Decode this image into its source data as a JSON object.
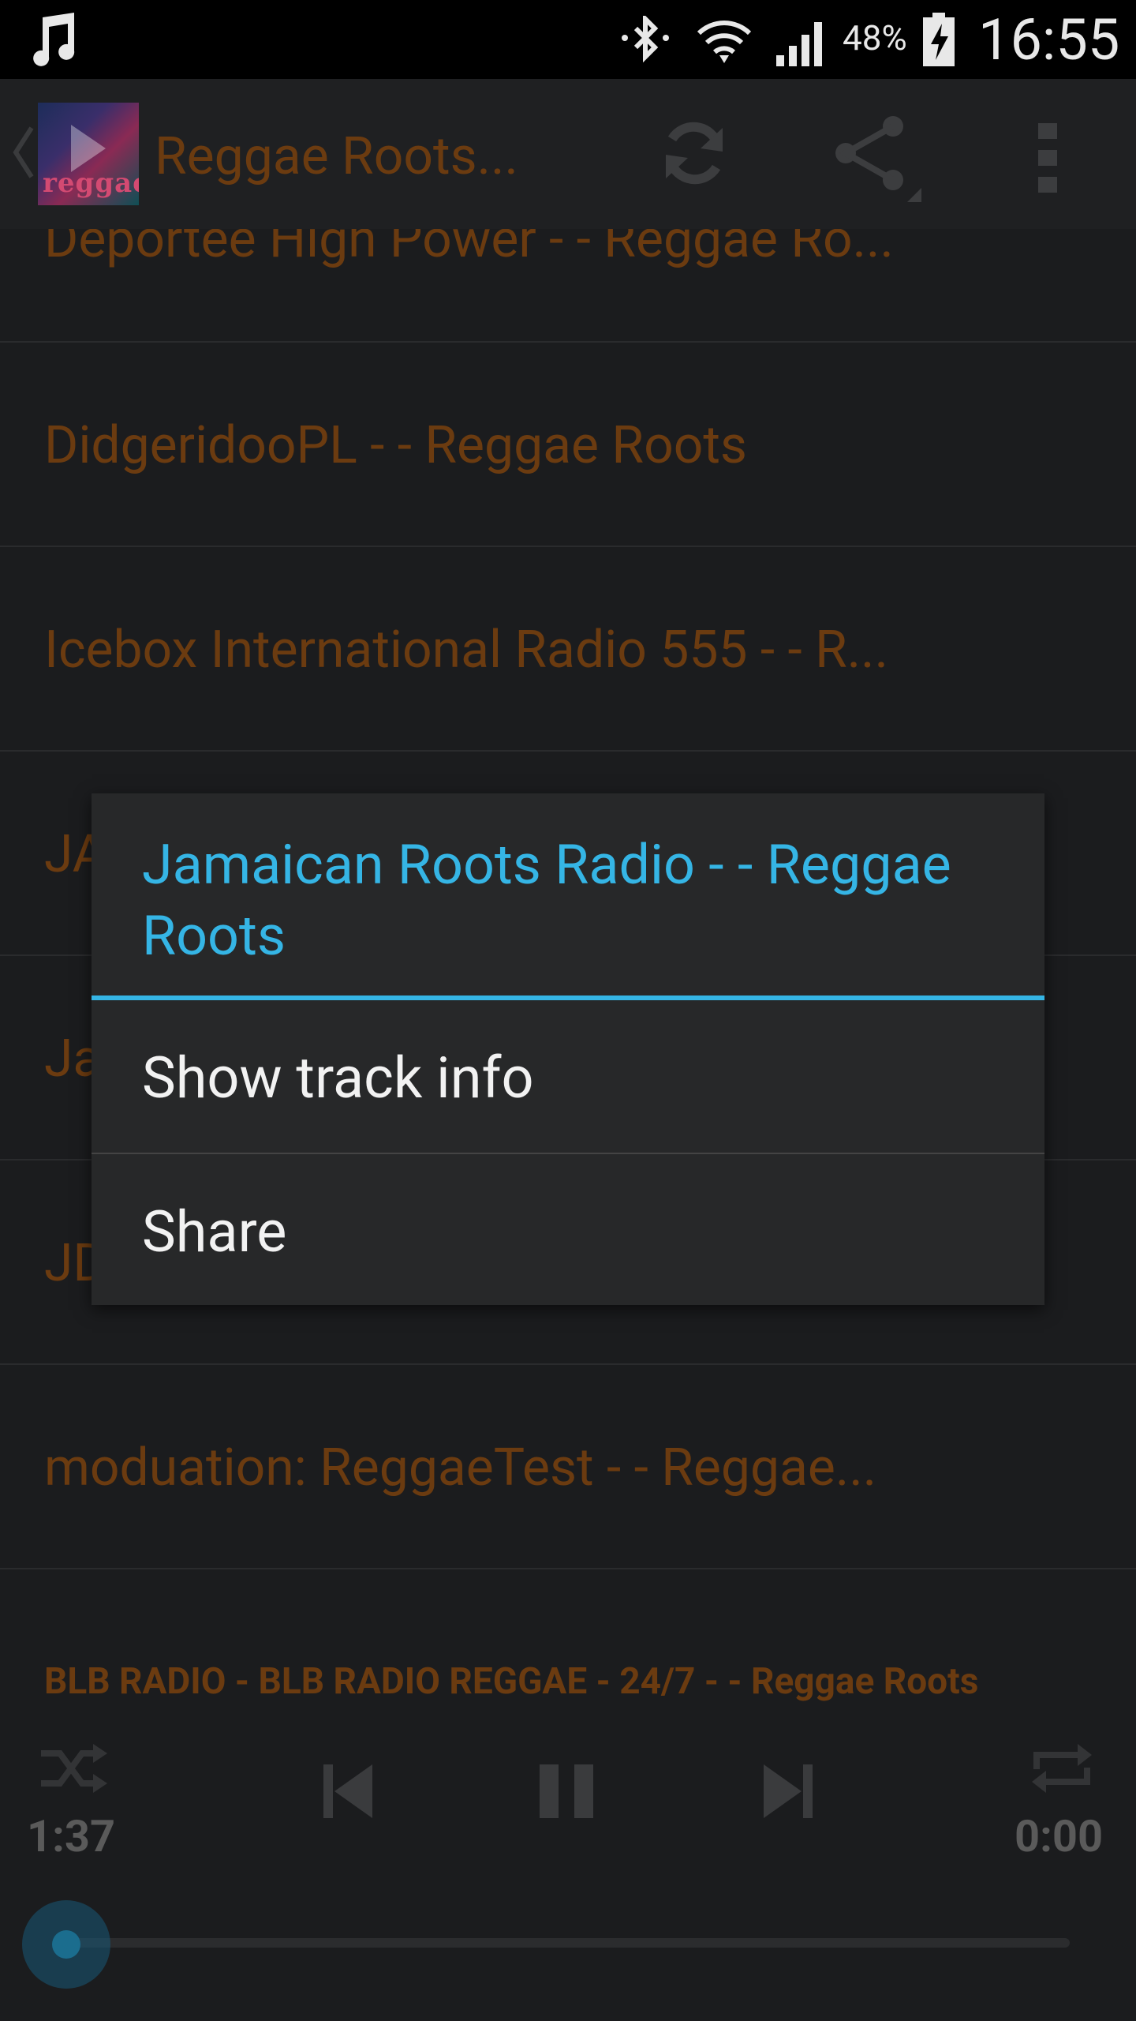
{
  "status_bar": {
    "battery_percent": "48%",
    "clock": "16:55"
  },
  "action_bar": {
    "title": "Reggae Roots...",
    "logo_text": "reggae",
    "icons": [
      "back-chevron-icon",
      "refresh-icon",
      "share-icon",
      "overflow-menu-icon"
    ]
  },
  "stations": [
    {
      "label": "Deportee High Power - - Reggae Ro..."
    },
    {
      "label": "DidgeridooPL - - Reggae Roots"
    },
    {
      "label": "Icebox International Radio 555 - - R..."
    },
    {
      "label": "JA"
    },
    {
      "label": "Ja"
    },
    {
      "label": "JD"
    },
    {
      "label": "moduation: ReggaeTest - - Reggae..."
    }
  ],
  "context_menu": {
    "title": "Jamaican Roots Radio - - Reggae Roots",
    "items": [
      {
        "label": "Show track info"
      },
      {
        "label": "Share"
      }
    ],
    "accent_color": "#35b5e5"
  },
  "player": {
    "now_playing": "BLB RADIO - BLB RADIO REGGAE - 24/7 - - Reggae Roots",
    "elapsed": "1:37",
    "duration": "0:00",
    "controls": [
      "shuffle-icon",
      "previous-icon",
      "pause-icon",
      "next-icon",
      "repeat-icon"
    ]
  }
}
